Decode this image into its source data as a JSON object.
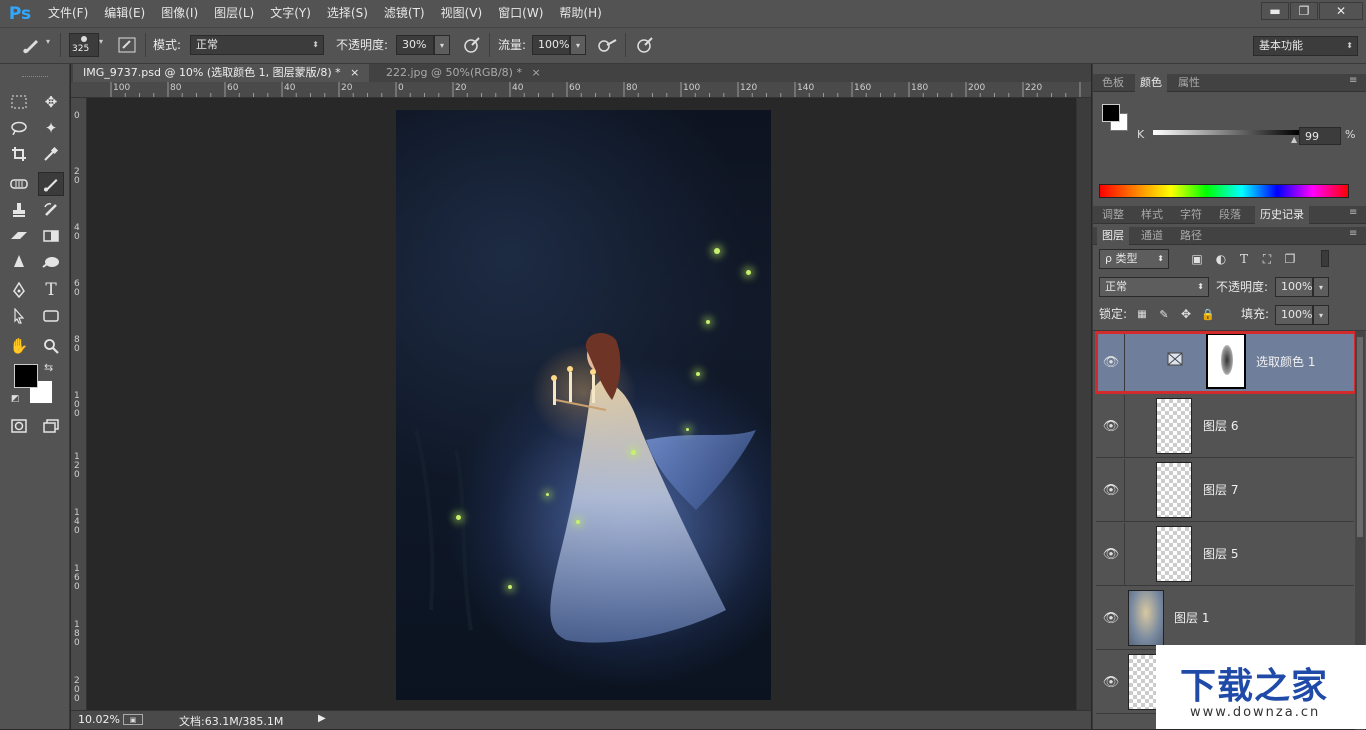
{
  "app": {
    "logo": "Ps",
    "window_min": "▬",
    "window_restore": "❐",
    "window_close": "✕"
  },
  "menu": [
    "文件(F)",
    "编辑(E)",
    "图像(I)",
    "图层(L)",
    "文字(Y)",
    "选择(S)",
    "滤镜(T)",
    "视图(V)",
    "窗口(W)",
    "帮助(H)"
  ],
  "options": {
    "brush_size": "325",
    "mode_label": "模式:",
    "mode_value": "正常",
    "opacity_label": "不透明度:",
    "opacity_value": "30%",
    "flow_label": "流量:",
    "flow_value": "100%",
    "workspace": "基本功能"
  },
  "tabs": [
    {
      "label": "IMG_9737.psd @ 10% (选取颜色 1, 图层蒙版/8) *",
      "close": "×",
      "active": true
    },
    {
      "label": "222.jpg @ 50%(RGB/8) *",
      "close": "×",
      "active": false
    }
  ],
  "ruler_top": [
    "100",
    "80",
    "60",
    "40",
    "20",
    "0",
    "20",
    "40",
    "60",
    "80",
    "100",
    "120",
    "140",
    "160",
    "180",
    "200",
    "220"
  ],
  "ruler_left": [
    "0",
    "20",
    "40",
    "60",
    "80",
    "100",
    "120",
    "140",
    "160",
    "180",
    "200"
  ],
  "status": {
    "zoom": "10.02%",
    "doc_info": "文档:63.1M/385.1M",
    "arrow": "▶"
  },
  "color_panel": {
    "tabs": [
      "色板",
      "颜色",
      "属性"
    ],
    "active_tab": "颜色",
    "channel_label": "K",
    "value": "99",
    "unit": "%",
    "foreground": "#000000",
    "background": "#ffffff"
  },
  "mid_tabs": [
    "调整",
    "样式",
    "字符",
    "段落",
    "历史记录"
  ],
  "mid_active": "历史记录",
  "layers_panel": {
    "tabs": [
      "图层",
      "通道",
      "路径"
    ],
    "active_tab": "图层",
    "filter_label": "ρ 类型",
    "blend_mode": "正常",
    "opacity_label": "不透明度:",
    "opacity_value": "100%",
    "lock_label": "锁定:",
    "fill_label": "填充:",
    "fill_value": "100%",
    "layers": [
      {
        "name": "选取颜色 1",
        "type": "adjustment",
        "selected": true
      },
      {
        "name": "图层 6",
        "type": "empty",
        "selected": false
      },
      {
        "name": "图层 7",
        "type": "empty",
        "selected": false
      },
      {
        "name": "图层 5",
        "type": "empty",
        "selected": false
      },
      {
        "name": "图层 1",
        "type": "image",
        "selected": false
      },
      {
        "name": "",
        "type": "empty",
        "selected": false
      }
    ]
  },
  "watermark": {
    "title": "下载之家",
    "url": "www.downza.cn"
  },
  "colors": {
    "accent": "#31a8ff",
    "highlight_border": "#d22b2b",
    "selected_layer": "#6f7e9a"
  }
}
